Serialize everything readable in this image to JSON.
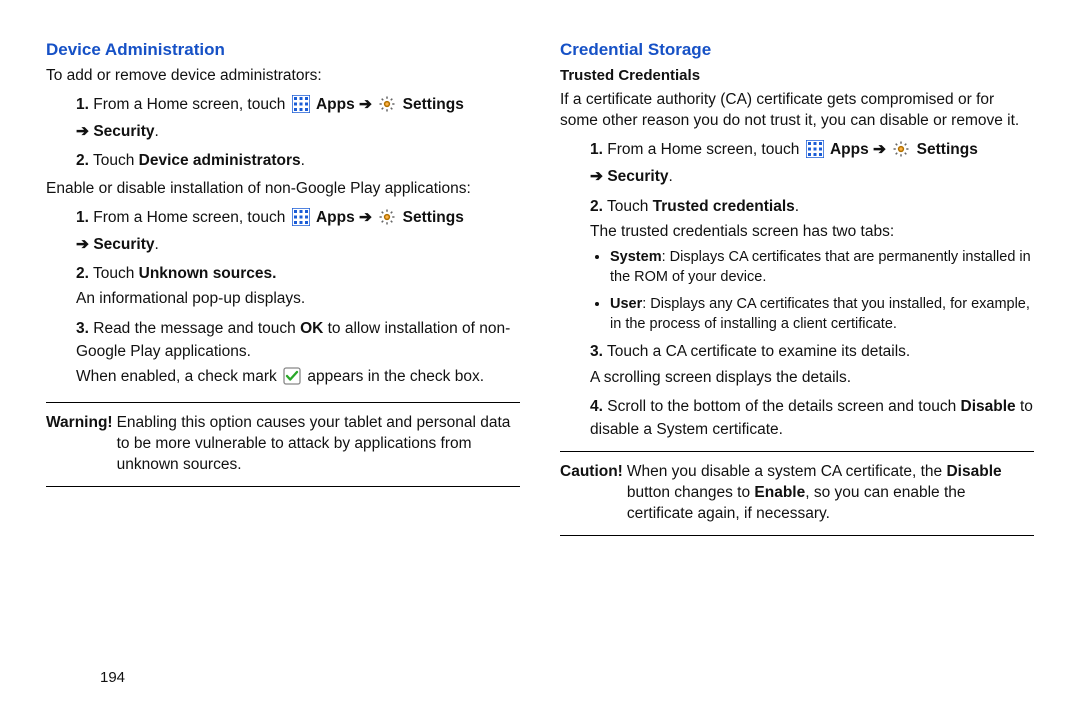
{
  "left": {
    "heading": "Device Administration",
    "intro": "To add or remove device administrators:",
    "path": {
      "prefix": "From a Home screen, touch",
      "apps": "Apps",
      "settings": "Settings",
      "security": "Security"
    },
    "step2a": "Touch ",
    "step2a_bold": "Device administrators",
    "step2a_end": ".",
    "nonplay_intro": "Enable or disable installation of non-Google Play applications:",
    "unknown_touch": "Touch ",
    "unknown_bold": "Unknown sources.",
    "popup": "An informational pop-up displays.",
    "step3_pre": "Read the message and touch ",
    "ok": "OK",
    "step3_post": " to allow installation of non-Google Play applications.",
    "checkmark_pre": "When enabled, a check mark ",
    "checkmark_post": " appears in the check box.",
    "warning_label": "Warning!",
    "warning_body": "Enabling this option causes your tablet and personal data to be more vulnerable to attack by applications from unknown sources."
  },
  "right": {
    "heading": "Credential Storage",
    "sub": "Trusted Credentials",
    "intro": "If a certificate authority (CA) certificate gets compromised or for some other reason you do not trust it, you can disable or remove it.",
    "path": {
      "prefix": "From a Home screen, touch",
      "apps": "Apps",
      "settings": "Settings",
      "security": "Security"
    },
    "step2": "Touch ",
    "step2_bold": "Trusted credentials",
    "step2_end": ".",
    "tabs_intro": "The trusted credentials screen has two tabs:",
    "system_label": "System",
    "system_body": ": Displays CA certificates that are permanently installed in the ROM of your device.",
    "user_label": "User",
    "user_body": ": Displays any CA certificates that you installed, for example, in the process of installing a client certificate.",
    "step3a": "Touch a CA certificate to examine its details.",
    "step3b": "A scrolling screen displays the details.",
    "step4_pre": "Scroll to the bottom of the details screen and touch ",
    "disable": "Disable",
    "step4_post": " to disable a System certificate.",
    "caution_label": "Caution!",
    "caution_pre": "When you disable a system CA certificate, the ",
    "caution_disable": "Disable",
    "caution_mid": " button changes to ",
    "enable": "Enable",
    "caution_post": ", so you can enable the certificate again, if necessary."
  },
  "icons": {
    "apps": "apps-grid-icon",
    "settings": "gear-icon",
    "check": "checkmark-icon",
    "arrow": "➔"
  },
  "page_number": "194"
}
